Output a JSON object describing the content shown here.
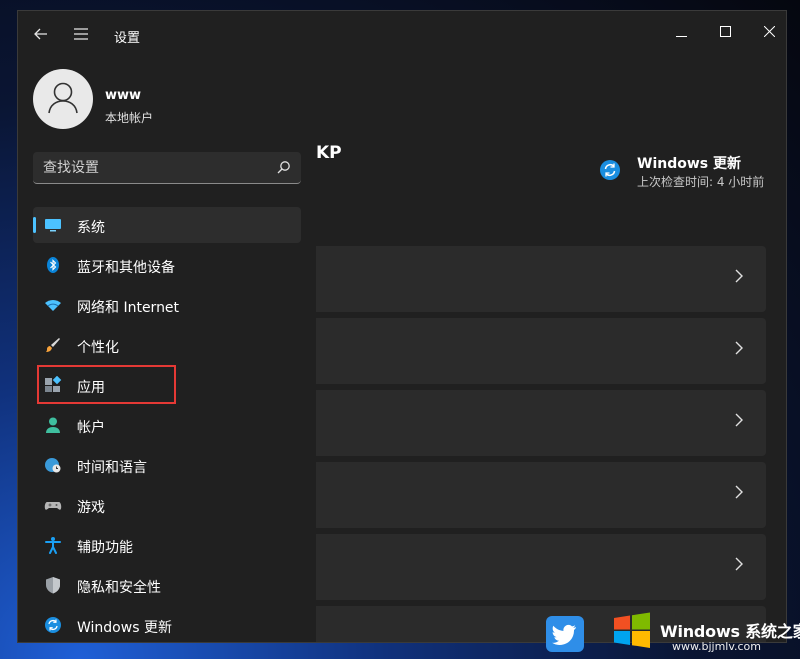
{
  "window": {
    "title": "设置",
    "controls": {
      "minimize": "—",
      "maximize": "☐",
      "close": "✕"
    }
  },
  "profile": {
    "name": "www",
    "account_type": "本地帐户"
  },
  "search": {
    "placeholder": "查找设置"
  },
  "nav": {
    "items": [
      {
        "label": "系统",
        "icon": "system-monitor-icon",
        "active": true
      },
      {
        "label": "蓝牙和其他设备",
        "icon": "bluetooth-icon"
      },
      {
        "label": "网络和 Internet",
        "icon": "wifi-icon"
      },
      {
        "label": "个性化",
        "icon": "paintbrush-icon"
      },
      {
        "label": "应用",
        "icon": "apps-icon",
        "highlighted": true
      },
      {
        "label": "帐户",
        "icon": "account-icon"
      },
      {
        "label": "时间和语言",
        "icon": "globe-clock-icon"
      },
      {
        "label": "游戏",
        "icon": "gamepad-icon"
      },
      {
        "label": "辅助功能",
        "icon": "accessibility-icon"
      },
      {
        "label": "隐私和安全性",
        "icon": "shield-icon"
      },
      {
        "label": "Windows 更新",
        "icon": "windows-update-icon"
      }
    ]
  },
  "main": {
    "device_name": "KP",
    "update_widget": {
      "title": "Windows 更新",
      "subtitle": "上次检查时间: 4 小时前"
    }
  },
  "watermark": {
    "title": "Windows 系统之家",
    "url": "www.bjjmlv.com"
  },
  "colors": {
    "accent": "#4cc2ff",
    "highlight_border": "#e53935",
    "window_bg": "#202020",
    "card_bg": "#2b2b2b"
  }
}
